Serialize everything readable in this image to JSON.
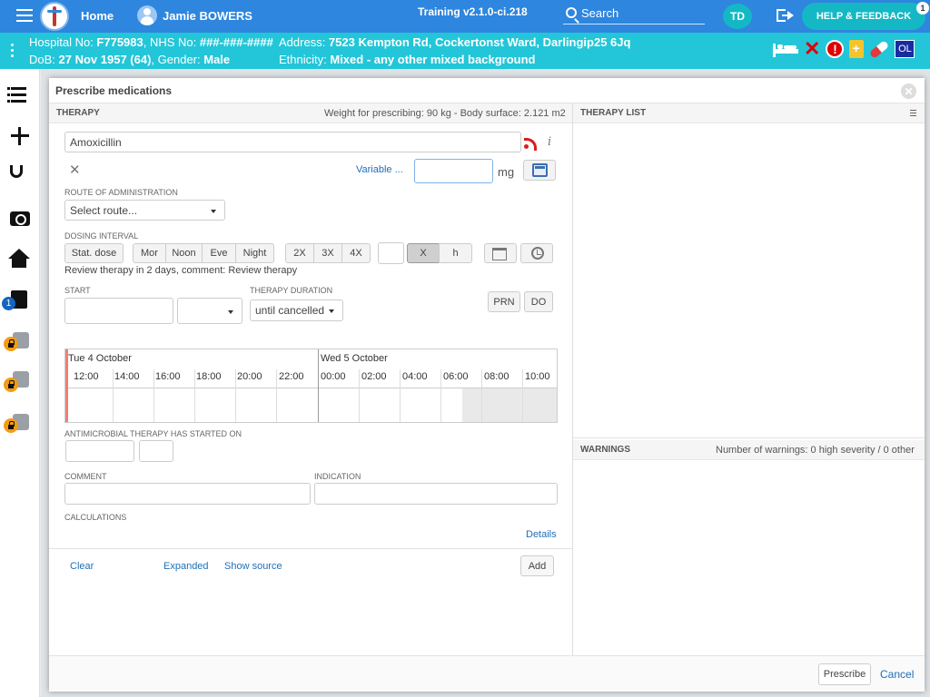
{
  "topbar": {
    "home": "Home",
    "patient_name": "Jamie BOWERS",
    "version": "Training v2.1.0-ci.218",
    "search": "Search",
    "user_initials": "TD",
    "help": "HELP & FEEDBACK",
    "help_badge": "1"
  },
  "banner": {
    "hospital_label": "Hospital No: ",
    "hospital_no": "F775983",
    "nhs_label": ", NHS No: ",
    "nhs_no": "###-###-####",
    "dob_label": "DoB: ",
    "dob": "27 Nov 1957 (64)",
    "gender_label": ", Gender: ",
    "gender": "Male",
    "address_label": "Address: ",
    "address": "7523 Kempton Rd, Cockertonst Ward, Darlingip25 6Jq",
    "ethnicity_label": "Ethnicity: ",
    "ethnicity": "Mixed - any other mixed background",
    "ol_badge": "OL"
  },
  "sidebar": {
    "notes_badge": "1"
  },
  "dialog": {
    "title": "Prescribe medications",
    "therapy_header": "THERAPY",
    "weight_info": "Weight for prescribing: 90 kg - Body surface: 2.121 m2",
    "therapy_list_header": "THERAPY LIST",
    "warnings_header": "WARNINGS",
    "warnings_info": "Number of warnings: 0 high severity / 0 other",
    "medication": "Amoxicillin",
    "variable_link": "Variable ...",
    "dose_value": "",
    "dose_unit": "mg",
    "route_label": "ROUTE OF ADMINISTRATION",
    "route_select": "Select route...",
    "dosing_label": "DOSING INTERVAL",
    "stat_dose": "Stat. dose",
    "times": [
      "Mor",
      "Noon",
      "Eve",
      "Night"
    ],
    "multipliers": [
      "2X",
      "3X",
      "4X"
    ],
    "x_btn": "X",
    "h_btn": "h",
    "review_text": "Review therapy in 2 days, comment: Review therapy",
    "start_label": "START",
    "duration_label": "THERAPY DURATION",
    "duration_value": "until cancelled",
    "prn": "PRN",
    "do": "DO",
    "timeline": {
      "day1": "Tue 4 October",
      "day2": "Wed 5 October",
      "hours": [
        "12:00",
        "14:00",
        "16:00",
        "18:00",
        "20:00",
        "22:00",
        "00:00",
        "02:00",
        "04:00",
        "06:00",
        "08:00",
        "10:00"
      ]
    },
    "antimicrobial_label": "ANTIMICROBIAL THERAPY HAS STARTED ON",
    "comment_label": "COMMENT",
    "indication_label": "INDICATION",
    "calculations_label": "CALCULATIONS",
    "details_link": "Details",
    "clear_link": "Clear",
    "expanded_link": "Expanded",
    "show_source_link": "Show source",
    "add_button": "Add",
    "prescribe_button": "Prescribe",
    "cancel_link": "Cancel"
  },
  "colors": {
    "topbar": "#2e86de",
    "banner": "#22c6d8",
    "accent": "#14b8c4",
    "link": "#1e6fb8",
    "alert": "#e00000"
  }
}
